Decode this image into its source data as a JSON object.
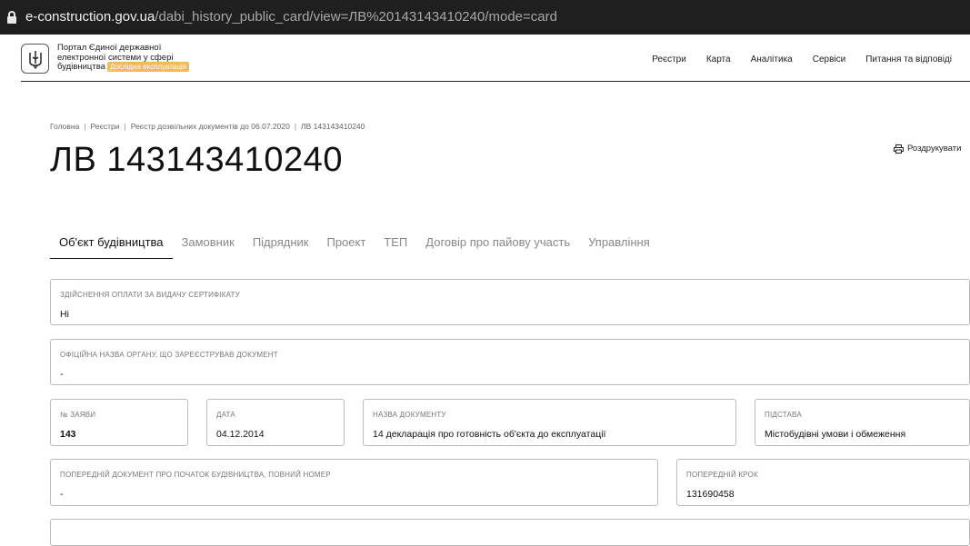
{
  "browser": {
    "url_domain": "e-construction.gov.ua",
    "url_path": "/dabi_history_public_card/view=ЛВ%20143143410240/mode=card"
  },
  "header": {
    "brand_line1": "Портал Єдиної державної",
    "brand_line2": "електронної системи у сфері",
    "brand_line3": "будівництва",
    "badge": "Дослідна експлуатація",
    "nav": [
      "Реєстри",
      "Карта",
      "Аналітика",
      "Сервіси",
      "Питання та відповіді"
    ]
  },
  "breadcrumb": [
    "Головна",
    "Реєстри",
    "Реєстр дозвільних документів до 06.07.2020",
    "ЛВ 143143410240"
  ],
  "page_title": "ЛВ 143143410240",
  "print_label": "Роздрукувати",
  "tabs": [
    "Об'єкт будівництва",
    "Замовник",
    "Підрядник",
    "Проект",
    "ТЕП",
    "Договір про пайову участь",
    "Управління"
  ],
  "active_tab": 0,
  "fields": {
    "payment": {
      "label": "Здійснення оплати за видачу сертифікату",
      "value": "Ні"
    },
    "organ": {
      "label": "Офіційна назва органу, що зареєстрував документ",
      "value": "-"
    },
    "app_no": {
      "label": "№ заяви",
      "value": "143"
    },
    "date": {
      "label": "Дата",
      "value": "04.12.2014"
    },
    "doc_name": {
      "label": "Назва документу",
      "value": "14 декларація про готовність об'єкта до експлуатації"
    },
    "basis": {
      "label": "Підстава",
      "value": "Містобудівні умови і обмеження"
    },
    "prev_doc": {
      "label": "Попередній документ про початок будівництва, повний номер",
      "value": "-"
    },
    "prev_step": {
      "label": "Попередній крок",
      "value": "131690458"
    }
  }
}
